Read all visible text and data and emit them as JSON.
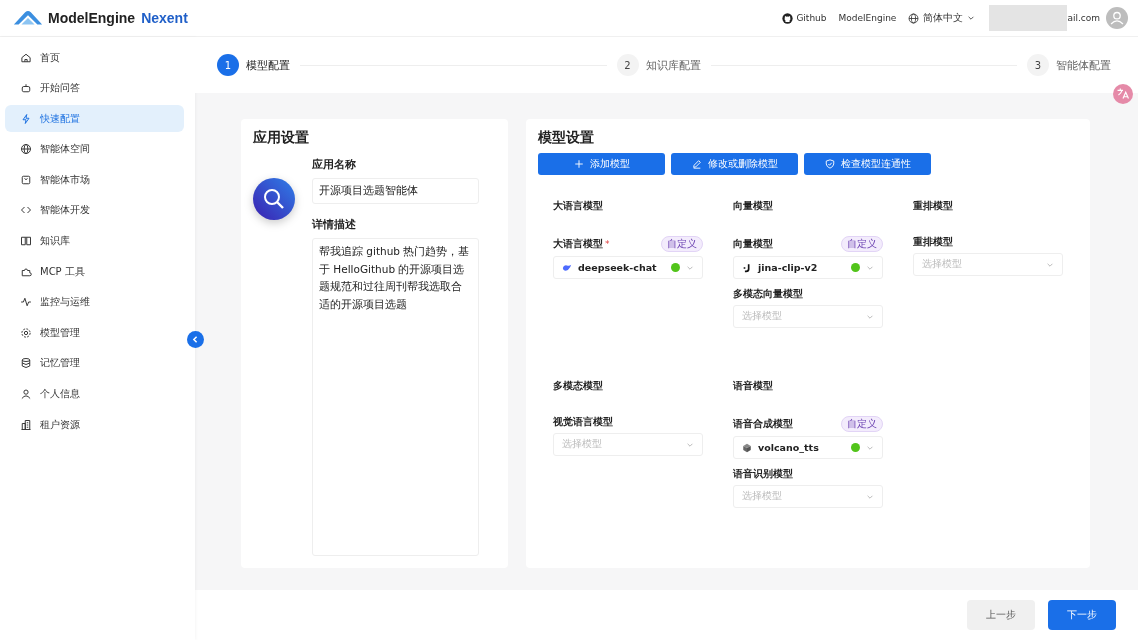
{
  "header": {
    "logo": {
      "brand": "ModelEngine",
      "product": "Nexent"
    },
    "links": [
      {
        "kind": "github",
        "label": "Github"
      },
      {
        "kind": "text",
        "label": "ModelEngine"
      }
    ],
    "language": "简体中文",
    "user_email": "ail.com"
  },
  "sidebar": {
    "items": [
      {
        "label": "首页",
        "selected": false
      },
      {
        "label": "开始问答",
        "selected": false
      },
      {
        "label": "快速配置",
        "selected": true
      },
      {
        "label": "智能体空间",
        "selected": false
      },
      {
        "label": "智能体市场",
        "selected": false
      },
      {
        "label": "智能体开发",
        "selected": false
      },
      {
        "label": "知识库",
        "selected": false
      },
      {
        "label": "MCP 工具",
        "selected": false
      },
      {
        "label": "监控与运维",
        "selected": false
      },
      {
        "label": "模型管理",
        "selected": false
      },
      {
        "label": "记忆管理",
        "selected": false
      },
      {
        "label": "个人信息",
        "selected": false
      },
      {
        "label": "租户资源",
        "selected": false
      }
    ]
  },
  "steps": [
    {
      "number": "1",
      "label": "模型配置",
      "selected": true
    },
    {
      "number": "2",
      "label": "知识库配置",
      "selected": false
    },
    {
      "number": "3",
      "label": "智能体配置",
      "selected": false
    }
  ],
  "app_settings": {
    "title": "应用设置",
    "name_label": "应用名称",
    "name_value": "开源项目选题智能体",
    "description_label": "详情描述",
    "description_value": "帮我追踪 github 热门趋势，基于 HelloGithub 的开源项目选题规范和过往周刊帮我选取合适的开源项目选题"
  },
  "model_settings": {
    "title": "模型设置",
    "buttons": [
      "添加模型",
      "修改或删除模型",
      "检查模型连通性"
    ],
    "groups": [
      {
        "title": "大语言模型",
        "fields": [
          {
            "label": "大语言模型",
            "required_mark": "*",
            "badge": "自定义",
            "value": "deepseek-chat",
            "kind": "whale",
            "connected": true
          }
        ]
      },
      {
        "title": "向量模型",
        "fields": [
          {
            "label": "向量模型",
            "badge": "自定义",
            "value": "jina-clip-v2",
            "kind": "letter",
            "connected": true
          },
          {
            "label": "多模态向量模型",
            "placeholder": "选择模型"
          }
        ]
      },
      {
        "title": "重排模型",
        "fields": [
          {
            "label": "重排模型",
            "placeholder": "选择模型"
          }
        ]
      },
      {
        "title": "多模态模型",
        "fields": [
          {
            "label": "视觉语言模型",
            "placeholder": "选择模型"
          }
        ]
      },
      {
        "title": "语音模型",
        "fields": [
          {
            "label": "语音合成模型",
            "badge": "自定义",
            "value": "volcano_tts",
            "kind": "cube",
            "connected": true
          },
          {
            "label": "语音识别模型",
            "placeholder": "选择模型"
          }
        ]
      }
    ]
  },
  "footer": {
    "buttons": [
      {
        "kind": "secondary",
        "label": "上一步"
      },
      {
        "kind": "primary",
        "label": "下一步"
      }
    ]
  }
}
